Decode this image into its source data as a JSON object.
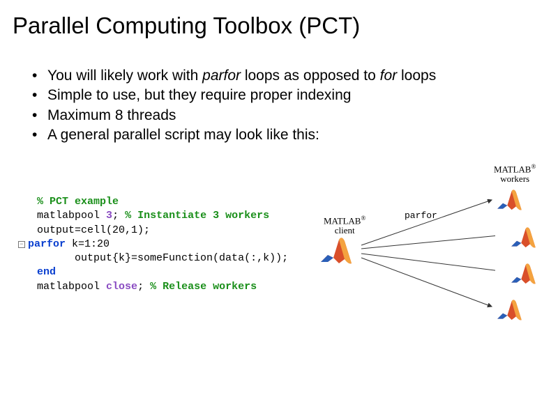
{
  "title": "Parallel Computing Toolbox (PCT)",
  "bullets": [
    {
      "pre": "You will likely work with ",
      "i1": "parfor",
      "mid": " loops as opposed to ",
      "i2": "for",
      "post": " loops"
    },
    {
      "text": "Simple to use, but they require proper indexing"
    },
    {
      "text": "Maximum 8 threads"
    },
    {
      "text": "A general parallel script may look like this:"
    }
  ],
  "code": {
    "l1_comment": "% PCT example",
    "l2_a": "matlabpool ",
    "l2_b": "3",
    "l2_c": "; ",
    "l2_d": "% Instantiate 3 workers",
    "l3": "output=cell(20,1);",
    "l4_a": "parfor ",
    "l4_b": "k=1:20",
    "l5": "      output{k}=someFunction(data(:,k));",
    "l6": "end",
    "l7_a": "matlabpool ",
    "l7_b": "close",
    "l7_c": "; ",
    "l7_d": "% Release workers",
    "fold_symbol": "−"
  },
  "diagram": {
    "client_label_1": "MATLAB",
    "client_label_2": "client",
    "workers_label_1": "MATLAB",
    "workers_label_2": "workers",
    "parfor_label": "parfor",
    "reg_mark": "®"
  }
}
